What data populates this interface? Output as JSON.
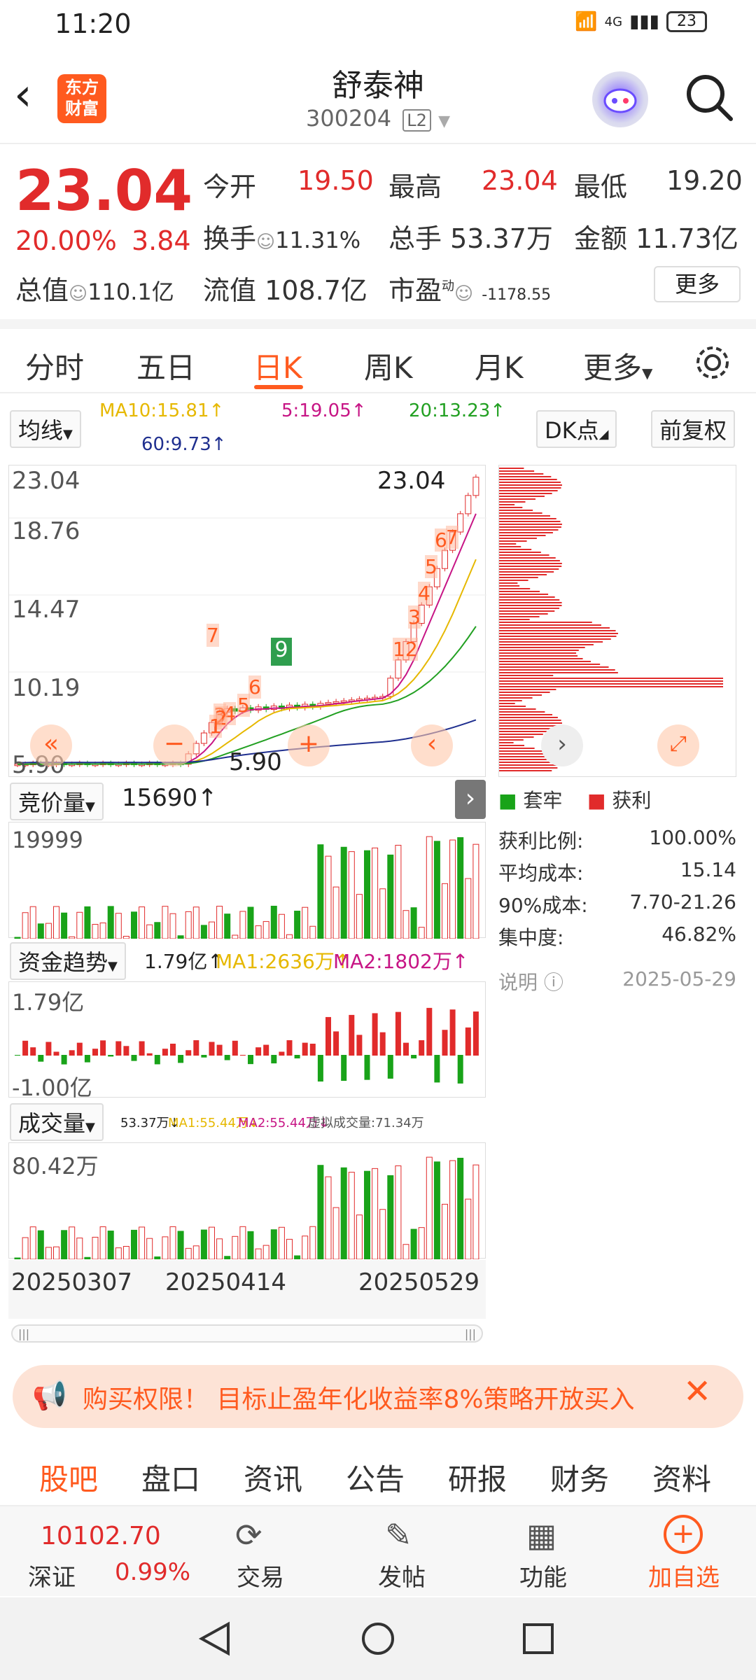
{
  "status": {
    "time": "11:20",
    "net": "4G",
    "battery": "23"
  },
  "header": {
    "title": "舒泰神",
    "code": "300204",
    "level": "L2",
    "logo_line1": "东方",
    "logo_line2": "财富"
  },
  "quote": {
    "price": "23.04",
    "pct": "20.00%",
    "change": "3.84",
    "open_label": "今开",
    "open": "19.50",
    "high_label": "最高",
    "high": "23.04",
    "low_label": "最低",
    "low": "19.20",
    "turnover_label": "换手",
    "turnover": "11.31%",
    "volume_label": "总手",
    "volume": "53.37万",
    "amount_label": "金额",
    "amount": "11.73亿",
    "mktcap_label": "总值",
    "mktcap": "110.1亿",
    "float_label": "流值",
    "float": "108.7亿",
    "pe_label": "市盈",
    "pe_sup": "动",
    "pe": "-1178.55",
    "more": "更多"
  },
  "tabs": [
    "分时",
    "五日",
    "日K",
    "周K",
    "月K",
    "更多"
  ],
  "ma_bar": {
    "select": "均线",
    "ma10": "MA10:15.81↑",
    "ma5": "5:19.05↑",
    "ma20": "20:13.23↑",
    "ma60": "60:9.73↑",
    "dk": "DK点",
    "fq": "前复权"
  },
  "kline": {
    "y_labels": [
      "23.04",
      "18.76",
      "14.47",
      "10.19",
      "5.90"
    ],
    "max_label": "23.04",
    "min_label": "5.90",
    "signal_9": "9",
    "markers": [
      "1",
      "2",
      "3",
      "4",
      "5",
      "6",
      "7",
      "12",
      "3",
      "4",
      "5",
      "6",
      "7"
    ]
  },
  "chip": {
    "legend_trap": "套牢",
    "legend_profit": "获利",
    "rows": [
      {
        "label": "获利比例:",
        "value": "100.00%"
      },
      {
        "label": "平均成本:",
        "value": "15.14"
      },
      {
        "label": "90%成本:",
        "value": "7.70-21.26"
      },
      {
        "label": "集中度:",
        "value": "46.82%"
      }
    ],
    "note": "说明",
    "date": "2025-05-29"
  },
  "auction": {
    "select": "竞价量",
    "value": "15690↑",
    "ylabel": "19999"
  },
  "flow": {
    "select": "资金趋势",
    "value": "1.79亿↑",
    "ma1": "MA1:2636万↑",
    "ma2": "MA2:1802万↑",
    "top": "1.79亿",
    "bottom": "-1.00亿"
  },
  "vol": {
    "select": "成交量",
    "value": "53.37万↓",
    "ma1": "MA1:55.44万↓",
    "ma2": "MA2:55.44万↓",
    "virt": "虚拟成交量:71.34万",
    "top": "80.42万"
  },
  "dates": [
    "20250307",
    "20250414",
    "20250529"
  ],
  "banner": {
    "text": "购买权限！ 目标止盈年化收益率8%策略开放买入"
  },
  "bottom_tabs": [
    "股吧",
    "盘口",
    "资讯",
    "公告",
    "研报",
    "财务",
    "资料"
  ],
  "footer": {
    "index_value": "10102.70",
    "index_name": "深证",
    "index_pct": "0.99%",
    "trade": "交易",
    "post": "发帖",
    "func": "功能",
    "add": "加自选"
  },
  "colors": {
    "up": "#e12b2b",
    "down": "#19a319",
    "accent": "#ff5a1f",
    "ma5": "#c71585",
    "ma10": "#e6b800",
    "ma20": "#22a022",
    "ma60": "#1f2f8f"
  }
}
